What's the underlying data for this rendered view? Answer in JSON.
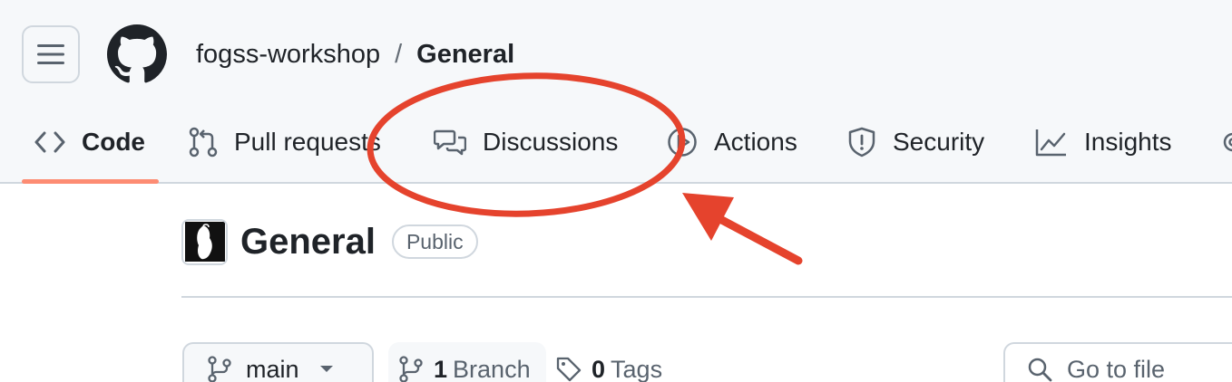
{
  "header": {
    "menu_icon": "hamburger-icon",
    "logo_icon": "github-mark-icon",
    "breadcrumb": {
      "owner": "fogss-workshop",
      "separator": "/",
      "repo": "General"
    }
  },
  "tabs": [
    {
      "label": "Code",
      "icon": "code-icon",
      "selected": true
    },
    {
      "label": "Pull requests",
      "icon": "pull-request-icon"
    },
    {
      "label": "Discussions",
      "icon": "discussions-icon"
    },
    {
      "label": "Actions",
      "icon": "play-icon"
    },
    {
      "label": "Security",
      "icon": "shield-icon"
    },
    {
      "label": "Insights",
      "icon": "graph-icon"
    }
  ],
  "repo": {
    "name": "General",
    "visibility": "Public"
  },
  "toolbar": {
    "branch": "main",
    "branches_count": "1",
    "branches_label": "Branch",
    "tags_count": "0",
    "tags_label": "Tags",
    "goto_placeholder": "Go to file"
  },
  "colors": {
    "accent_underline": "#fd8c73",
    "annotation": "#e5432d",
    "header_bg": "#f6f8fa",
    "border": "#d0d7de"
  }
}
